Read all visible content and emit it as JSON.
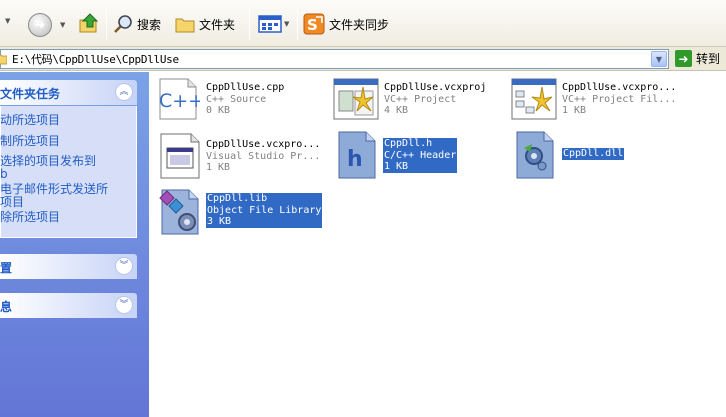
{
  "toolbar": {
    "search_label": "搜索",
    "folders_label": "文件夹",
    "sync_label": "文件夹同步"
  },
  "address": {
    "path": "E:\\代码\\CppDllUse\\CppDllUse",
    "go_label": "转到"
  },
  "sidebar": {
    "tasks_title": "文件夹任务",
    "tasks": [
      "动所选项目",
      "制所选项目",
      "选择的项目发布到",
      "b",
      "电子邮件形式发送所",
      "项目",
      "除所选项目"
    ],
    "places_title": "置",
    "details_title": "息"
  },
  "files": [
    {
      "name": "CppDllUse.cpp",
      "type": "C++ Source",
      "size": "0 KB",
      "icon": "cpp-source-icon",
      "selected": false
    },
    {
      "name": "CppDllUse.vcxproj",
      "type": "VC++ Project",
      "size": "4 KB",
      "icon": "vc-project-icon",
      "selected": false
    },
    {
      "name": "CppDllUse.vcxpro...",
      "type": "VC++ Project Fil...",
      "size": "1 KB",
      "icon": "vc-project-filters-icon",
      "selected": false
    },
    {
      "name": "CppDllUse.vcxpro...",
      "type": "Visual Studio Pr...",
      "size": "1 KB",
      "icon": "vs-user-file-icon",
      "selected": false
    },
    {
      "name": "CppDll.h",
      "type": "C/C++ Header",
      "size": "1 KB",
      "icon": "header-file-icon",
      "selected": true
    },
    {
      "name": "CppDll.dll",
      "type": "",
      "size": "",
      "icon": "dll-file-icon",
      "selected": true
    },
    {
      "name": "CppDll.lib",
      "type": "Object File Library",
      "size": "3 KB",
      "icon": "lib-file-icon",
      "selected": true
    }
  ],
  "colors": {
    "selection": "#316ac5",
    "task_link": "#215dc6",
    "sidebar_top": "#7ba2e7",
    "sidebar_bottom": "#6375d6"
  }
}
